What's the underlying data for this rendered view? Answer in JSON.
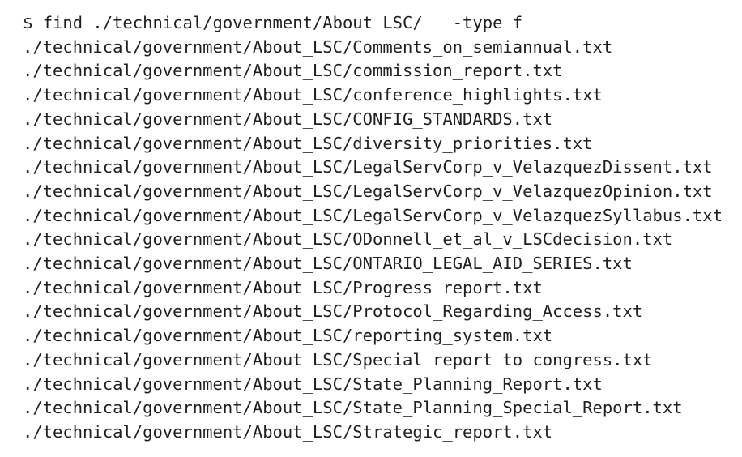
{
  "terminal": {
    "prompt": "$",
    "command": "find ./technical/government/About_LSC/   -type f",
    "output": [
      "./technical/government/About_LSC/Comments_on_semiannual.txt",
      "./technical/government/About_LSC/commission_report.txt",
      "./technical/government/About_LSC/conference_highlights.txt",
      "./technical/government/About_LSC/CONFIG_STANDARDS.txt",
      "./technical/government/About_LSC/diversity_priorities.txt",
      "./technical/government/About_LSC/LegalServCorp_v_VelazquezDissent.txt",
      "./technical/government/About_LSC/LegalServCorp_v_VelazquezOpinion.txt",
      "./technical/government/About_LSC/LegalServCorp_v_VelazquezSyllabus.txt",
      "./technical/government/About_LSC/ODonnell_et_al_v_LSCdecision.txt",
      "./technical/government/About_LSC/ONTARIO_LEGAL_AID_SERIES.txt",
      "./technical/government/About_LSC/Progress_report.txt",
      "./technical/government/About_LSC/Protocol_Regarding_Access.txt",
      "./technical/government/About_LSC/reporting_system.txt",
      "./technical/government/About_LSC/Special_report_to_congress.txt",
      "./technical/government/About_LSC/State_Planning_Report.txt",
      "./technical/government/About_LSC/State_Planning_Special_Report.txt",
      "./technical/government/About_LSC/Strategic_report.txt"
    ]
  }
}
